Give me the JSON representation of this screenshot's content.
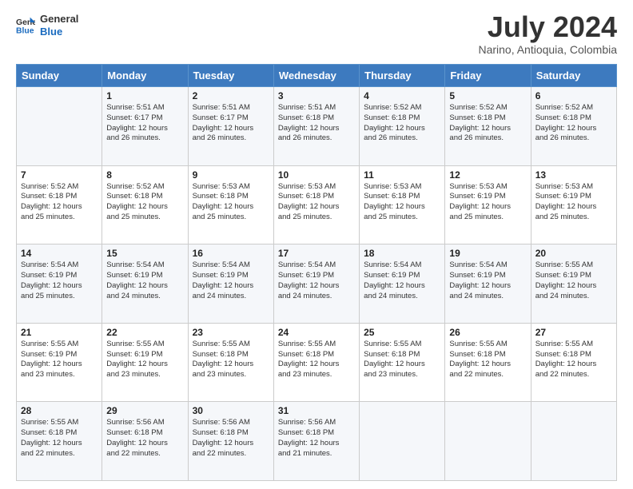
{
  "logo": {
    "line1": "General",
    "line2": "Blue"
  },
  "title": "July 2024",
  "location": "Narino, Antioquia, Colombia",
  "weekdays": [
    "Sunday",
    "Monday",
    "Tuesday",
    "Wednesday",
    "Thursday",
    "Friday",
    "Saturday"
  ],
  "weeks": [
    [
      {
        "day": "",
        "info": ""
      },
      {
        "day": "1",
        "info": "Sunrise: 5:51 AM\nSunset: 6:17 PM\nDaylight: 12 hours\nand 26 minutes."
      },
      {
        "day": "2",
        "info": "Sunrise: 5:51 AM\nSunset: 6:17 PM\nDaylight: 12 hours\nand 26 minutes."
      },
      {
        "day": "3",
        "info": "Sunrise: 5:51 AM\nSunset: 6:18 PM\nDaylight: 12 hours\nand 26 minutes."
      },
      {
        "day": "4",
        "info": "Sunrise: 5:52 AM\nSunset: 6:18 PM\nDaylight: 12 hours\nand 26 minutes."
      },
      {
        "day": "5",
        "info": "Sunrise: 5:52 AM\nSunset: 6:18 PM\nDaylight: 12 hours\nand 26 minutes."
      },
      {
        "day": "6",
        "info": "Sunrise: 5:52 AM\nSunset: 6:18 PM\nDaylight: 12 hours\nand 26 minutes."
      }
    ],
    [
      {
        "day": "7",
        "info": "Sunrise: 5:52 AM\nSunset: 6:18 PM\nDaylight: 12 hours\nand 25 minutes."
      },
      {
        "day": "8",
        "info": "Sunrise: 5:52 AM\nSunset: 6:18 PM\nDaylight: 12 hours\nand 25 minutes."
      },
      {
        "day": "9",
        "info": "Sunrise: 5:53 AM\nSunset: 6:18 PM\nDaylight: 12 hours\nand 25 minutes."
      },
      {
        "day": "10",
        "info": "Sunrise: 5:53 AM\nSunset: 6:18 PM\nDaylight: 12 hours\nand 25 minutes."
      },
      {
        "day": "11",
        "info": "Sunrise: 5:53 AM\nSunset: 6:18 PM\nDaylight: 12 hours\nand 25 minutes."
      },
      {
        "day": "12",
        "info": "Sunrise: 5:53 AM\nSunset: 6:19 PM\nDaylight: 12 hours\nand 25 minutes."
      },
      {
        "day": "13",
        "info": "Sunrise: 5:53 AM\nSunset: 6:19 PM\nDaylight: 12 hours\nand 25 minutes."
      }
    ],
    [
      {
        "day": "14",
        "info": "Sunrise: 5:54 AM\nSunset: 6:19 PM\nDaylight: 12 hours\nand 25 minutes."
      },
      {
        "day": "15",
        "info": "Sunrise: 5:54 AM\nSunset: 6:19 PM\nDaylight: 12 hours\nand 24 minutes."
      },
      {
        "day": "16",
        "info": "Sunrise: 5:54 AM\nSunset: 6:19 PM\nDaylight: 12 hours\nand 24 minutes."
      },
      {
        "day": "17",
        "info": "Sunrise: 5:54 AM\nSunset: 6:19 PM\nDaylight: 12 hours\nand 24 minutes."
      },
      {
        "day": "18",
        "info": "Sunrise: 5:54 AM\nSunset: 6:19 PM\nDaylight: 12 hours\nand 24 minutes."
      },
      {
        "day": "19",
        "info": "Sunrise: 5:54 AM\nSunset: 6:19 PM\nDaylight: 12 hours\nand 24 minutes."
      },
      {
        "day": "20",
        "info": "Sunrise: 5:55 AM\nSunset: 6:19 PM\nDaylight: 12 hours\nand 24 minutes."
      }
    ],
    [
      {
        "day": "21",
        "info": "Sunrise: 5:55 AM\nSunset: 6:19 PM\nDaylight: 12 hours\nand 23 minutes."
      },
      {
        "day": "22",
        "info": "Sunrise: 5:55 AM\nSunset: 6:19 PM\nDaylight: 12 hours\nand 23 minutes."
      },
      {
        "day": "23",
        "info": "Sunrise: 5:55 AM\nSunset: 6:18 PM\nDaylight: 12 hours\nand 23 minutes."
      },
      {
        "day": "24",
        "info": "Sunrise: 5:55 AM\nSunset: 6:18 PM\nDaylight: 12 hours\nand 23 minutes."
      },
      {
        "day": "25",
        "info": "Sunrise: 5:55 AM\nSunset: 6:18 PM\nDaylight: 12 hours\nand 23 minutes."
      },
      {
        "day": "26",
        "info": "Sunrise: 5:55 AM\nSunset: 6:18 PM\nDaylight: 12 hours\nand 22 minutes."
      },
      {
        "day": "27",
        "info": "Sunrise: 5:55 AM\nSunset: 6:18 PM\nDaylight: 12 hours\nand 22 minutes."
      }
    ],
    [
      {
        "day": "28",
        "info": "Sunrise: 5:55 AM\nSunset: 6:18 PM\nDaylight: 12 hours\nand 22 minutes."
      },
      {
        "day": "29",
        "info": "Sunrise: 5:56 AM\nSunset: 6:18 PM\nDaylight: 12 hours\nand 22 minutes."
      },
      {
        "day": "30",
        "info": "Sunrise: 5:56 AM\nSunset: 6:18 PM\nDaylight: 12 hours\nand 22 minutes."
      },
      {
        "day": "31",
        "info": "Sunrise: 5:56 AM\nSunset: 6:18 PM\nDaylight: 12 hours\nand 21 minutes."
      },
      {
        "day": "",
        "info": ""
      },
      {
        "day": "",
        "info": ""
      },
      {
        "day": "",
        "info": ""
      }
    ]
  ]
}
